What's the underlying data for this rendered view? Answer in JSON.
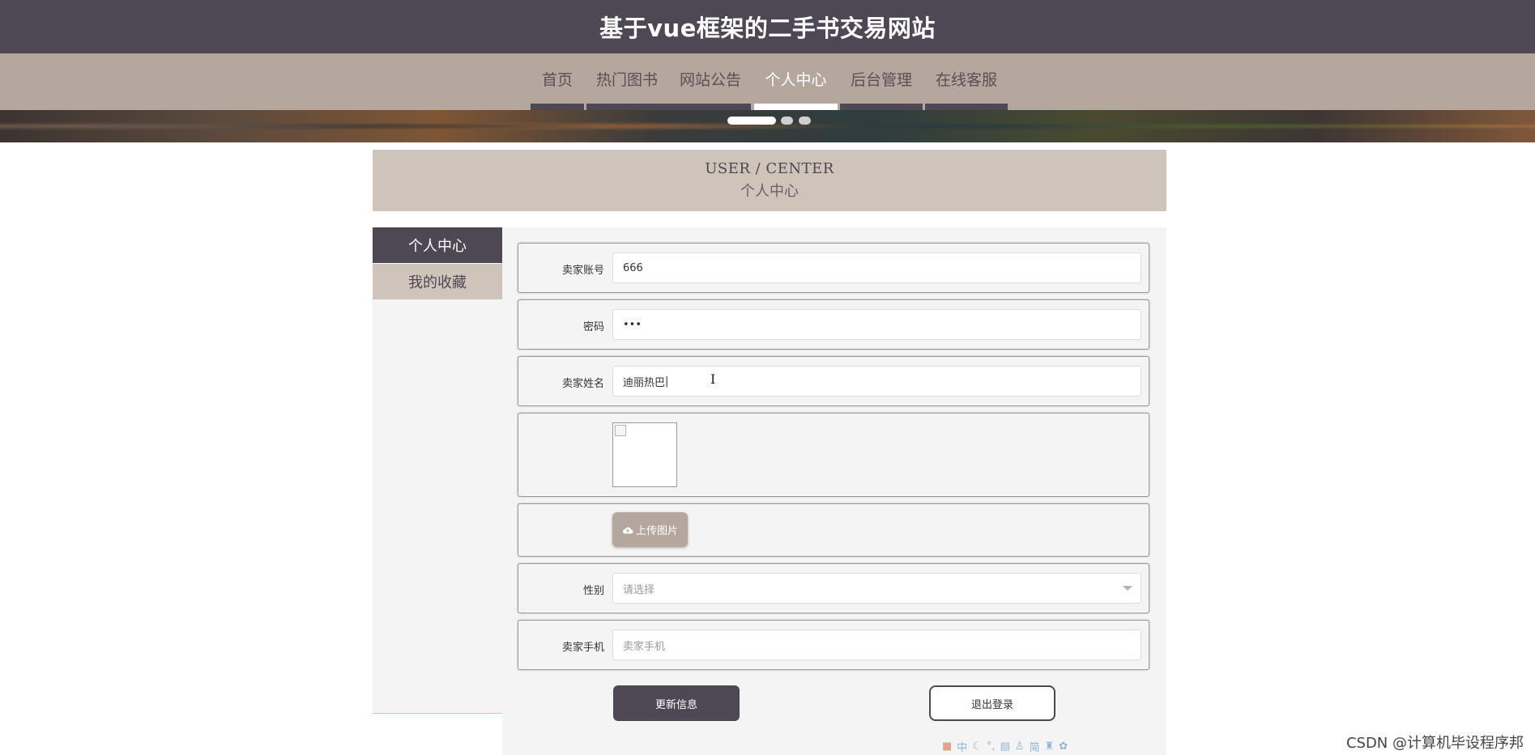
{
  "site": {
    "title": "基于vue框架的二手书交易网站"
  },
  "nav": {
    "items": [
      {
        "label": "首页",
        "active": false
      },
      {
        "label": "热门图书",
        "active": false
      },
      {
        "label": "网站公告",
        "active": false
      },
      {
        "label": "个人中心",
        "active": true
      },
      {
        "label": "后台管理",
        "active": false
      },
      {
        "label": "在线客服",
        "active": false
      }
    ]
  },
  "carousel": {
    "slide_count": 3,
    "active_index": 0
  },
  "section": {
    "title_en": "USER / CENTER",
    "title_cn": "个人中心"
  },
  "sidebar": {
    "items": [
      {
        "label": "个人中心",
        "active": true
      },
      {
        "label": "我的收藏",
        "active": false
      }
    ]
  },
  "form": {
    "account": {
      "label": "卖家账号",
      "value": "666"
    },
    "password": {
      "label": "密码",
      "value": "•••"
    },
    "name": {
      "label": "卖家姓名",
      "value": "迪丽热巴"
    },
    "upload": {
      "label": "上传图片",
      "icon": "cloud-upload-icon"
    },
    "gender": {
      "label": "性别",
      "placeholder": "请选择"
    },
    "phone": {
      "label": "卖家手机",
      "placeholder": "卖家手机"
    }
  },
  "actions": {
    "update_label": "更新信息",
    "logout_label": "退出登录"
  },
  "ime_toolbar": {
    "mode_label": "中",
    "simplified_label": "简"
  },
  "watermark": "CSDN @计算机毕设程序邦",
  "colors": {
    "header_bg": "#4e4855",
    "nav_bg": "#b5a79d",
    "section_bg": "#cec4b9",
    "panel_bg": "#f4f4f4",
    "accent_dark": "#4e4855"
  }
}
